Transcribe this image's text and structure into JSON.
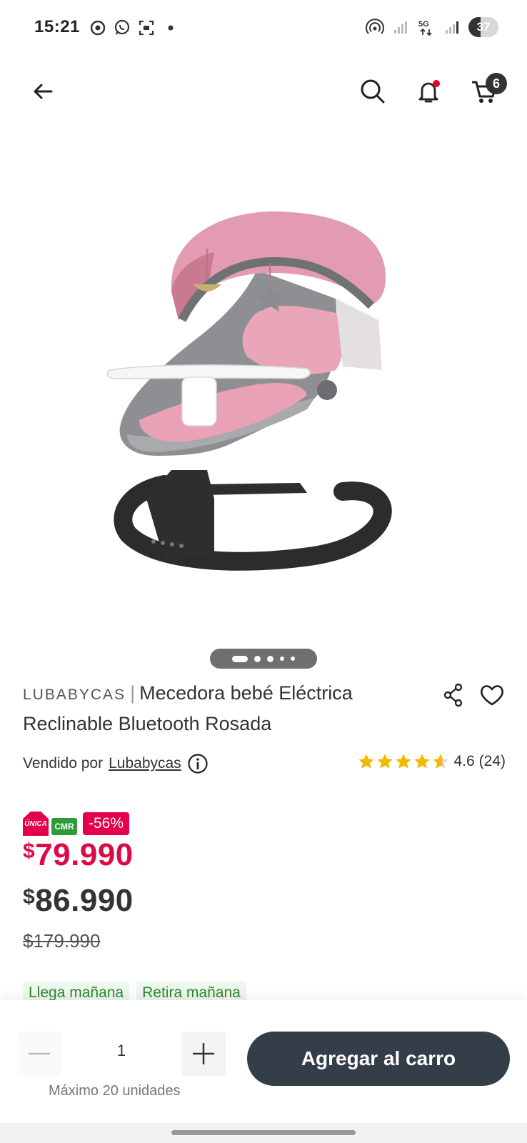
{
  "status_bar": {
    "time": "15:21",
    "left_icons": [
      "chrome-icon",
      "whatsapp-icon",
      "screenshot-icon",
      "dot-icon"
    ],
    "right_icons": [
      "hotspot-icon",
      "signal-icon",
      "5g-icon",
      "signal-icon"
    ],
    "battery_level": "37"
  },
  "header": {
    "icons": [
      "back-arrow-icon",
      "search-icon",
      "bell-icon",
      "cart-icon"
    ],
    "cart_count": "6"
  },
  "carousel": {
    "total": 5,
    "active_index": 0
  },
  "product": {
    "brand": "LUBABYCAS",
    "name": "Mecedora bebé Eléctrica Reclinable Bluetooth Rosada",
    "sold_by_label": "Vendido por",
    "seller": "Lubabycas",
    "rating": {
      "value": "4.6",
      "count": "(24)",
      "stars": 4.6
    },
    "badges": {
      "unica": "ÚNICA",
      "cmr": "CMR",
      "discount": "-56%"
    },
    "prices": {
      "currency": "$",
      "cmr_price": "79.990",
      "normal_price": "86.990",
      "old_price": "$179.990"
    },
    "delivery_tags": [
      "Llega mañana",
      "Retira mañana"
    ]
  },
  "purchase": {
    "quantity": "1",
    "max_text": "Máximo 20 unidades",
    "add_to_cart_label": "Agregar al carro"
  },
  "colors": {
    "cmr_price": "#dd0a46",
    "button": "#343e48",
    "star": "#f5b800",
    "tag_text": "#2d8a2d"
  }
}
